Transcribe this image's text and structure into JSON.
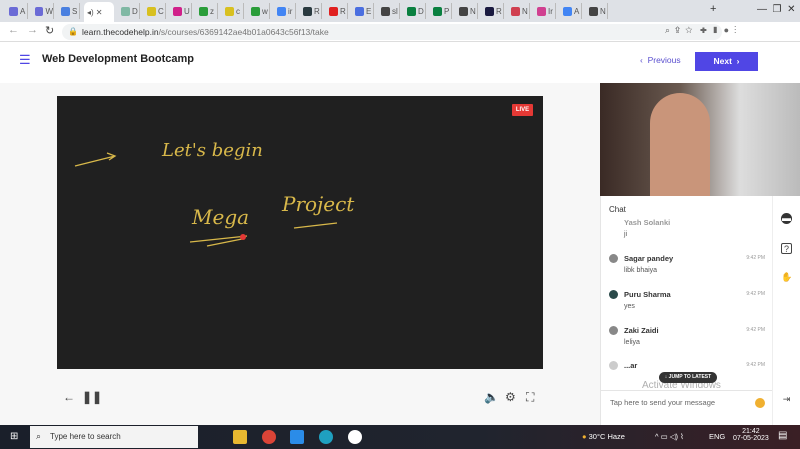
{
  "browser": {
    "tabs": [
      {
        "label": "A",
        "color": "#6b6bd6"
      },
      {
        "label": "W",
        "color": "#6b6bd6"
      },
      {
        "label": "S",
        "color": "#4a80e0"
      },
      {
        "label": "",
        "color": "#333",
        "active": true
      },
      {
        "label": "D",
        "color": "#7fb8a4"
      },
      {
        "label": "C",
        "color": "#d8c020"
      },
      {
        "label": "U",
        "color": "#d0208a"
      },
      {
        "label": "z",
        "color": "#2a9d3a"
      },
      {
        "label": "c",
        "color": "#d8c020"
      },
      {
        "label": "w",
        "color": "#2a9d3a"
      },
      {
        "label": "ir",
        "color": "#4285f4"
      },
      {
        "label": "R",
        "color": "#2a3a40"
      },
      {
        "label": "R",
        "color": "#e02020"
      },
      {
        "label": "E",
        "color": "#4a6ee0"
      },
      {
        "label": "sl",
        "color": "#444"
      },
      {
        "label": "D",
        "color": "#0a8040"
      },
      {
        "label": "P",
        "color": "#0a8040"
      },
      {
        "label": "N",
        "color": "#444"
      },
      {
        "label": "R",
        "color": "#1a1a40"
      },
      {
        "label": "N",
        "color": "#d04050"
      },
      {
        "label": "Ir",
        "color": "#d04090"
      },
      {
        "label": "A",
        "color": "#4285f4"
      },
      {
        "label": "N",
        "color": "#444"
      }
    ],
    "url_host": "learn.thecodehelp.in",
    "url_path": "/s/courses/6369142ae4b01a0643c56f13/take"
  },
  "header": {
    "title": "Web Development Bootcamp",
    "previous": "Previous",
    "next": "Next",
    "accent": "#5046e5"
  },
  "video": {
    "live_badge": "LIVE",
    "board": {
      "line1": "Let's begin",
      "word1": "Mega",
      "word2": "Project"
    }
  },
  "chat": {
    "title": "Chat",
    "messages": [
      {
        "name": "Yash Solanki",
        "time": "",
        "text": "ji"
      },
      {
        "name": "Sagar pandey",
        "time": "9:42 PM",
        "text": "libk bhaiya"
      },
      {
        "name": "Puru Sharma",
        "time": "9:42 PM",
        "text": "yes"
      },
      {
        "name": "Zaki Zaidi",
        "time": "9:42 PM",
        "text": "leliya"
      },
      {
        "name": "...ar",
        "time": "9:42 PM",
        "text": ""
      }
    ],
    "jump": "↓ JUMP TO LATEST",
    "placeholder": "Tap here to send your message",
    "watermark": "Activate Windows"
  },
  "taskbar": {
    "search": "Type here to search",
    "weather": "30°C  Haze",
    "lang": "ENG",
    "time": "21:42",
    "date": "07-05-2023"
  }
}
